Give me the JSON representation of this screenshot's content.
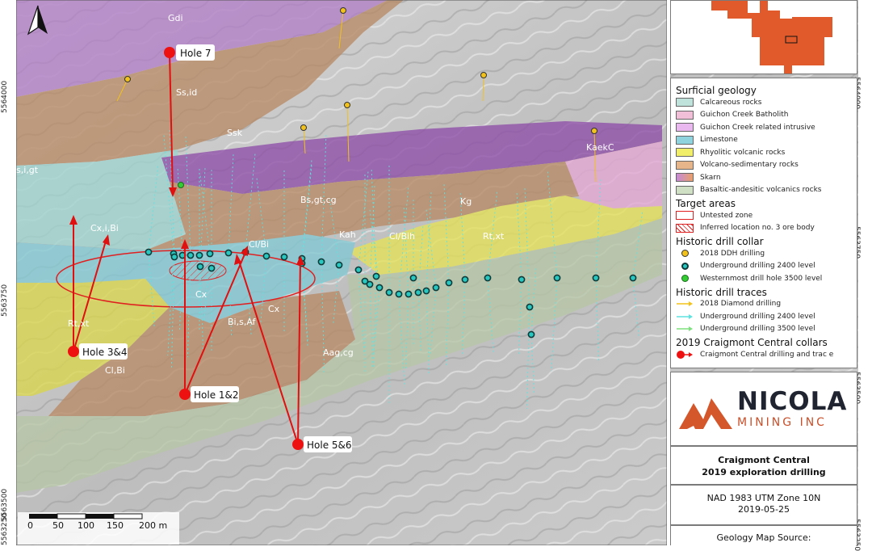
{
  "map": {
    "unit_labels": [
      {
        "text": "Gdi",
        "color": "#ffffff"
      },
      {
        "text": "Ss,id",
        "color": "#ffffff"
      },
      {
        "text": "Ssk",
        "color": "#ffffff"
      },
      {
        "text": "s,i,gt",
        "color": "#ffffff"
      },
      {
        "text": "Cx,i,Bi",
        "color": "#ffffff"
      },
      {
        "text": "Bs,gt,cg",
        "color": "#ffffff"
      },
      {
        "text": "Kg",
        "color": "#ffffff"
      },
      {
        "text": "KaekC",
        "color": "#ffffff"
      },
      {
        "text": "Kah",
        "color": "#ffffff"
      },
      {
        "text": "Cl/Bih",
        "color": "#ffffff"
      },
      {
        "text": "Rt,xt",
        "color": "#ffffff"
      },
      {
        "text": "Cl/Bi",
        "color": "#ffffff"
      },
      {
        "text": "Cx",
        "color": "#ffffff"
      },
      {
        "text": "Bi,s,Af",
        "color": "#ffffff"
      },
      {
        "text": "Cx",
        "color": "#ffffff"
      },
      {
        "text": "Rt,xt",
        "color": "#ffffff"
      },
      {
        "text": "Aag,cg",
        "color": "#ffffff"
      },
      {
        "text": "Cl,Bi",
        "color": "#ffffff"
      }
    ],
    "holes": [
      {
        "label": "Hole 7"
      },
      {
        "label": "Hole 3&4"
      },
      {
        "label": "Hole 1&2"
      },
      {
        "label": "Hole 5&6"
      }
    ],
    "coords_left": [
      "5564000",
      "5563750",
      "5563500",
      "5563250"
    ],
    "coords_right": [
      "5564000",
      "5563750",
      "5563500",
      "5563250"
    ],
    "north_arrow_icon": "north-arrow-icon",
    "scale_labels": [
      "0",
      "50",
      "100",
      "150",
      "200 m"
    ]
  },
  "legend": {
    "surficial_heading": "Surficial geology",
    "surficial_items": [
      {
        "label": "Calcareous rocks",
        "color": "#bfe3db"
      },
      {
        "label": "Guichon Creek Batholith",
        "color": "#f2bfd9"
      },
      {
        "label": "Guichon Creek related intrusive",
        "color": "#e8b8ee"
      },
      {
        "label": "Limestone",
        "color": "#8fd3df"
      },
      {
        "label": "Rhyolitic volcanic rocks",
        "color": "#f1ee6a"
      },
      {
        "label": "Volcano-sedimentary rocks",
        "color": "#e6b68a"
      },
      {
        "label": "Skarn",
        "color": "#c58ad8"
      },
      {
        "label": "Basaltic-andesitic volcanics rocks",
        "color": "#cfe0c4"
      }
    ],
    "target_heading": "Target areas",
    "target_items": [
      {
        "label": "Untested zone"
      },
      {
        "label": "Inferred location no. 3 ore body"
      }
    ],
    "collar_heading": "Historic drill collar",
    "collar_items": [
      {
        "label": "2018 DDH drilling",
        "color": "#f2c21b"
      },
      {
        "label": "Underground drilling 2400  level",
        "color": "#2ac7c0"
      },
      {
        "label": "Westernmost drill hole 3500 level",
        "color": "#33cc33"
      }
    ],
    "trace_heading": "Historic drill traces",
    "trace_items": [
      {
        "label": "2018 Diamond drilling",
        "color": "#f2c21b"
      },
      {
        "label": "Underground drilling 2400 level",
        "color": "#5fe3e0"
      },
      {
        "label": "Underground drilling 3500 level",
        "color": "#7ee07e"
      }
    ],
    "collars2019_heading": "2019 Craigmont Central collars",
    "collars2019_items": [
      {
        "label": "Craigmont Central drilling and trac e",
        "color": "#ee1111"
      }
    ]
  },
  "logo": {
    "name": "NICOLA",
    "sub": "MINING INC",
    "colors": {
      "mark": "#d4562b",
      "text": "#1f2430"
    }
  },
  "title": {
    "line1": "Craigmont Central",
    "line2": "2019 exploration drilling"
  },
  "projection": {
    "datum": "NAD 1983 UTM Zone 10N",
    "date": "2019-05-25"
  },
  "source": {
    "label": "Geology Map Source:"
  }
}
